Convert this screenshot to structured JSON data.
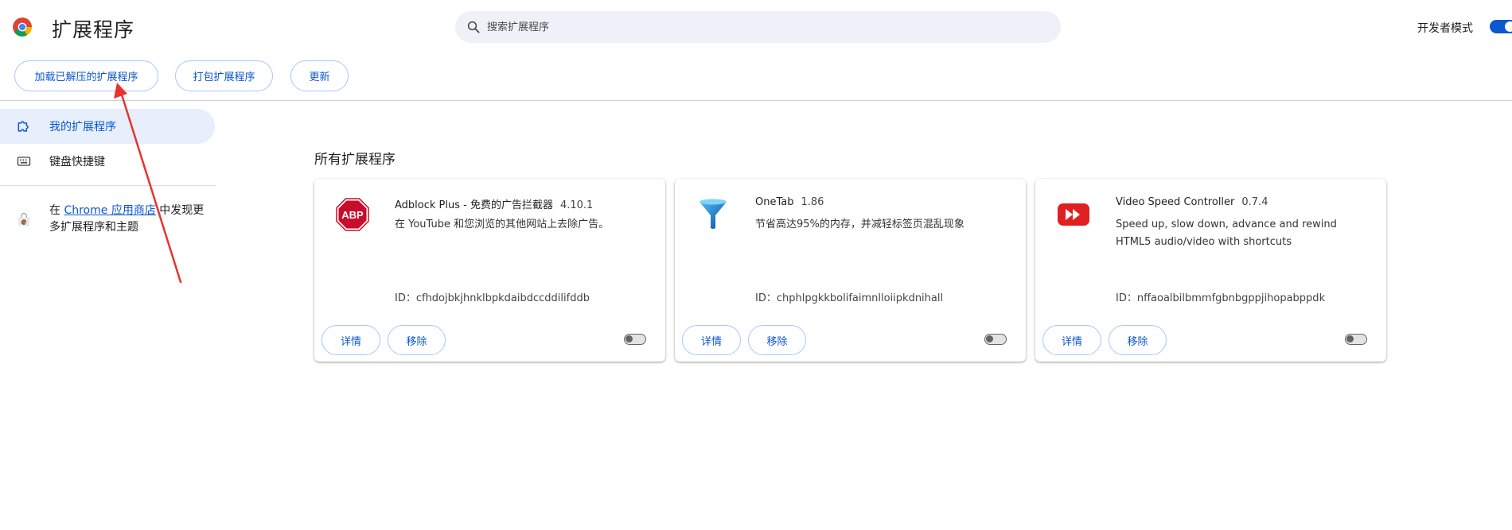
{
  "header": {
    "title": "扩展程序",
    "search_placeholder": "搜索扩展程序",
    "dev_mode_label": "开发者模式",
    "dev_mode_on": true
  },
  "toolbar": {
    "load_unpacked": "加载已解压的扩展程序",
    "pack": "打包扩展程序",
    "update": "更新"
  },
  "sidebar": {
    "items": [
      {
        "label": "我的扩展程序",
        "icon": "extension-icon",
        "active": true
      },
      {
        "label": "键盘快捷键",
        "icon": "keyboard-icon",
        "active": false
      }
    ],
    "webstore": {
      "prefix": "在 ",
      "link": "Chrome 应用商店",
      "suffix": " 中发现更多扩展程序和主题"
    }
  },
  "main": {
    "section_title": "所有扩展程序",
    "extensions": [
      {
        "name": "Adblock Plus - 免费的广告拦截器",
        "version": "4.10.1",
        "description": "在 YouTube 和您浏览的其他网站上去除广告。",
        "id": "ID：cfhdojbkjhnklbpkdaibdccddilifddb",
        "icon": "abp-icon",
        "enabled": false,
        "details_label": "详情",
        "remove_label": "移除"
      },
      {
        "name": "OneTab",
        "version": "1.86",
        "description": "节省高达95%的内存，并减轻标签页混乱现象",
        "id": "ID：chphlpgkkbolifaimnlloiipkdnihall",
        "icon": "onetab-funnel-icon",
        "enabled": false,
        "details_label": "详情",
        "remove_label": "移除"
      },
      {
        "name": "Video Speed Controller",
        "version": "0.7.4",
        "description": "Speed up, slow down, advance and rewind HTML5 audio/video with shortcuts",
        "id": "ID：nffaoalbilbmmfgbnbgppjihopabppdk",
        "icon": "fast-forward-icon",
        "enabled": false,
        "details_label": "详情",
        "remove_label": "移除"
      }
    ]
  },
  "colors": {
    "accent": "#0b57d0",
    "pill_border": "#a8c7fa",
    "search_bg": "#eef1f8",
    "annotation": "#e8322e"
  }
}
